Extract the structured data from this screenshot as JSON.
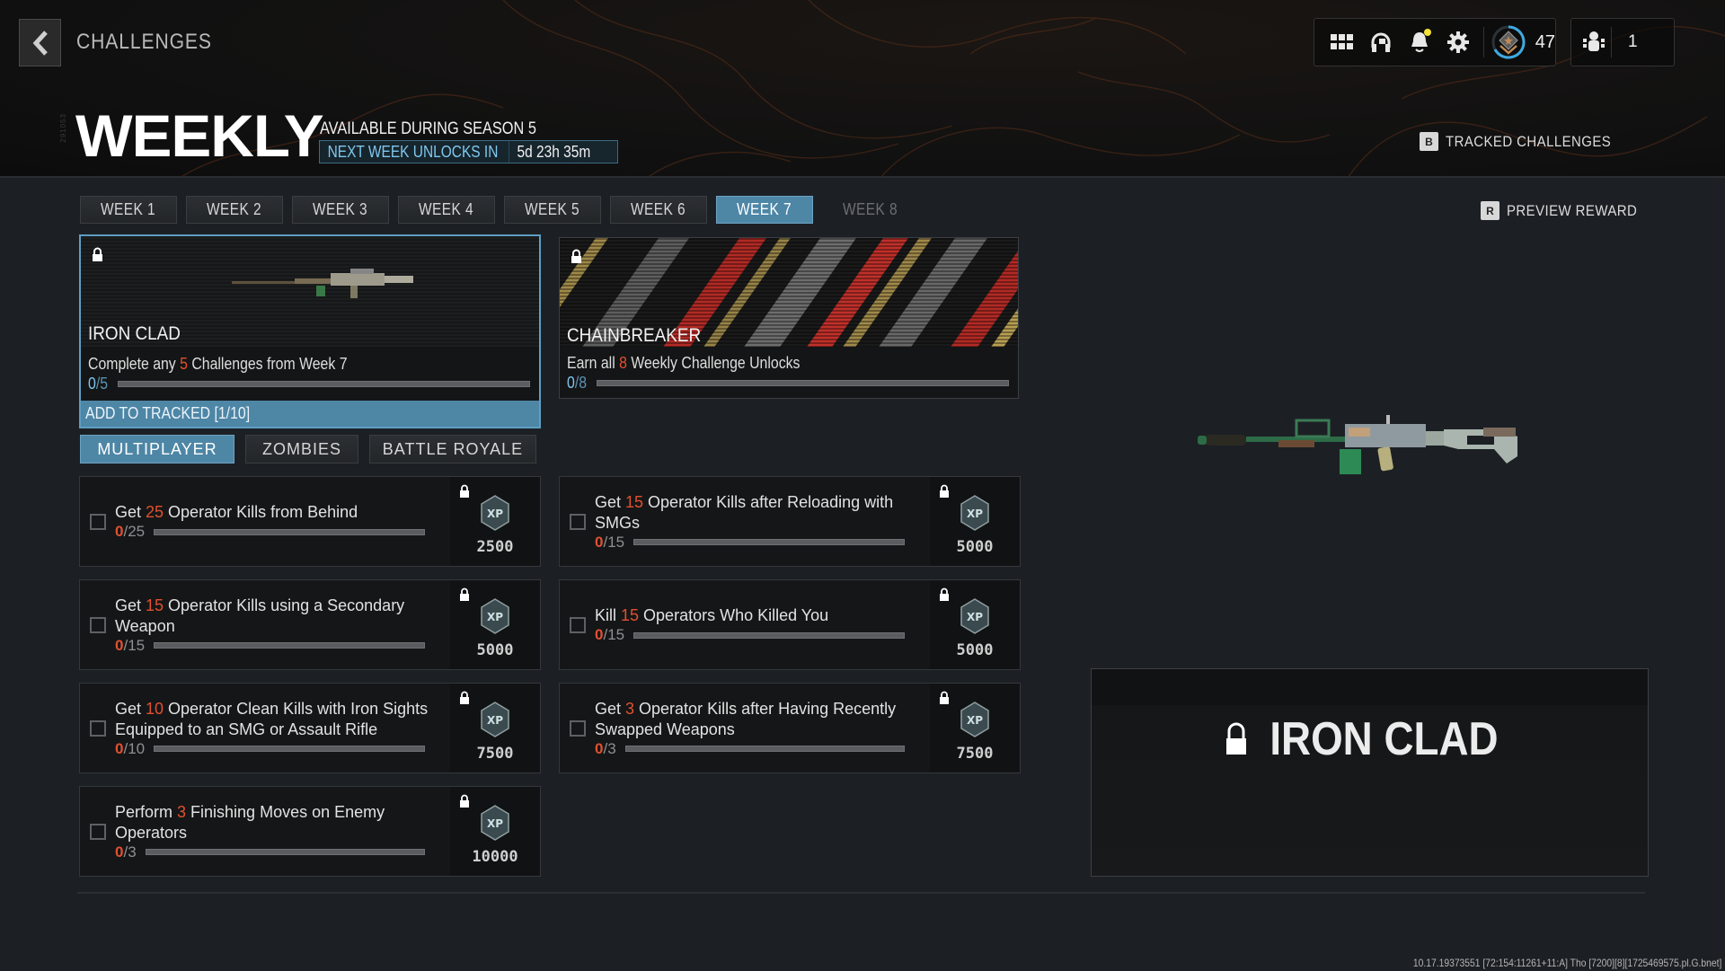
{
  "header": {
    "breadcrumb": "CHALLENGES",
    "vertical_label": "291053",
    "title": "WEEKLY",
    "season_text": "AVAILABLE DURING SEASON 5",
    "unlock_label": "NEXT WEEK UNLOCKS IN",
    "unlock_time": "5d 23h 35m",
    "tracked_key": "B",
    "tracked_label": "TRACKED CHALLENGES"
  },
  "topbar": {
    "icons": [
      "grid-menu-icon",
      "headset-icon",
      "bell-icon",
      "gear-icon",
      "rank-badge-icon"
    ],
    "notification_dot": true,
    "level": "47",
    "party_icon": "party-icon",
    "party_count": "1"
  },
  "week_tabs": [
    {
      "label": "WEEK 1",
      "state": "normal"
    },
    {
      "label": "WEEK 2",
      "state": "normal"
    },
    {
      "label": "WEEK 3",
      "state": "normal"
    },
    {
      "label": "WEEK 4",
      "state": "normal"
    },
    {
      "label": "WEEK 5",
      "state": "normal"
    },
    {
      "label": "WEEK 6",
      "state": "normal"
    },
    {
      "label": "WEEK 7",
      "state": "active"
    },
    {
      "label": "WEEK 8",
      "state": "locked"
    }
  ],
  "preview_hint": {
    "key": "R",
    "label": "PREVIEW REWARD"
  },
  "rewards": [
    {
      "name": "IRON CLAD",
      "desc_pre": "Complete any ",
      "desc_num": "5",
      "desc_post": " Challenges from Week 7",
      "progress_current": "0",
      "progress_total": "5",
      "progress_fraction": 0,
      "track_button": "ADD TO TRACKED [1/10]",
      "selected": true
    },
    {
      "name": "CHAINBREAKER",
      "desc_pre": "Earn all ",
      "desc_num": "8",
      "desc_post": " Weekly Challenge Unlocks",
      "progress_current": "0",
      "progress_total": "8",
      "progress_fraction": 0,
      "selected": false
    }
  ],
  "mode_tabs": [
    {
      "label": "MULTIPLAYER",
      "active": true
    },
    {
      "label": "ZOMBIES",
      "active": false
    },
    {
      "label": "BATTLE ROYALE",
      "active": false
    }
  ],
  "challenges": [
    {
      "pre": "Get ",
      "num": "25",
      "post": " Operator Kills from Behind",
      "current": "0",
      "total": "25",
      "progress_fraction": 0,
      "xp": "2500"
    },
    {
      "pre": "Get ",
      "num": "15",
      "post": " Operator Kills after Reloading with SMGs",
      "current": "0",
      "total": "15",
      "progress_fraction": 0,
      "xp": "5000"
    },
    {
      "pre": "Get ",
      "num": "15",
      "post": " Operator Kills using a Secondary Weapon",
      "current": "0",
      "total": "15",
      "progress_fraction": 0,
      "xp": "5000"
    },
    {
      "pre": "Kill ",
      "num": "15",
      "post": " Operators Who Killed You",
      "current": "0",
      "total": "15",
      "progress_fraction": 0,
      "xp": "5000"
    },
    {
      "pre": "Get ",
      "num": "10",
      "post": " Operator Clean Kills with Iron Sights Equipped to an SMG or Assault Rifle",
      "current": "0",
      "total": "10",
      "progress_fraction": 0,
      "xp": "7500"
    },
    {
      "pre": "Get ",
      "num": "3",
      "post": " Operator Kills after Having Recently Swapped Weapons",
      "current": "0",
      "total": "3",
      "progress_fraction": 0,
      "xp": "7500"
    },
    {
      "pre": "Perform ",
      "num": "3",
      "post": " Finishing Moves on Enemy Operators",
      "current": "0",
      "total": "3",
      "progress_fraction": 0,
      "xp": "10000"
    }
  ],
  "xp_badge_label": "XP",
  "preview": {
    "name": "IRON CLAD",
    "locked": true
  },
  "build_info": "10.17.19373551 [72:154:11261+11:A] Tho [7200][8][1725469575.pl.G.bnet]",
  "colors": {
    "accent_blue": "#4e86a6",
    "highlight_orange": "#e0512f",
    "notif_yellow": "#f2e13a",
    "rank_ring": "#3fa9e0"
  }
}
